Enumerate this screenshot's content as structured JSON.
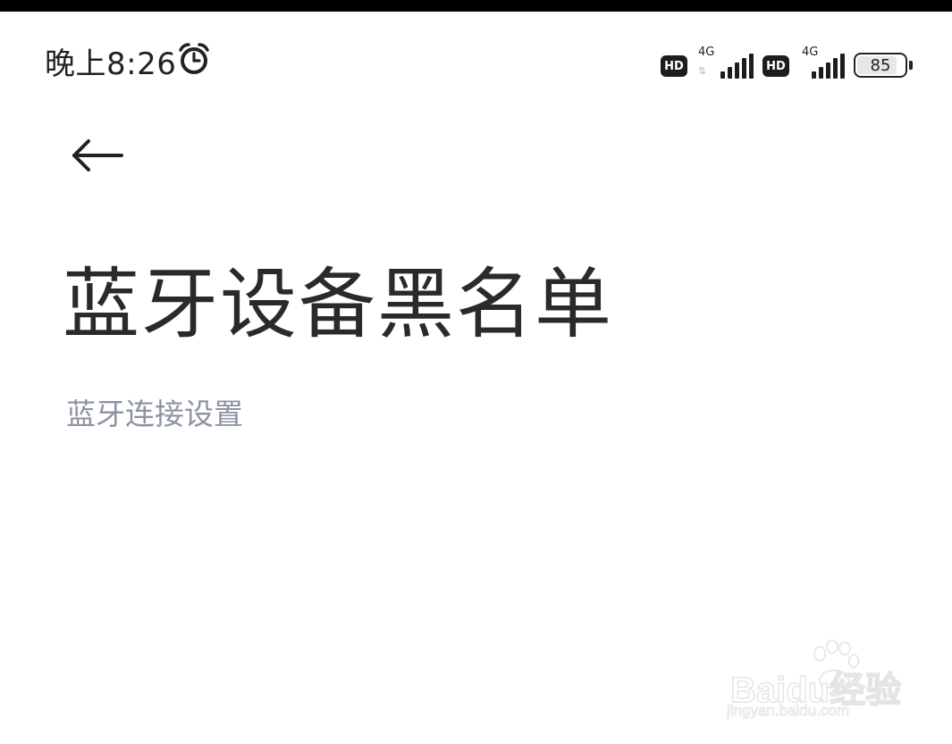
{
  "status_bar": {
    "time": "晚上8:26",
    "alarm_icon": "alarm-clock-icon",
    "sim1": {
      "hd": "HD",
      "network": "4G",
      "bars": 5
    },
    "sim2": {
      "hd": "HD",
      "network": "4G",
      "bars": 5
    },
    "battery": {
      "percent": "85",
      "level": 0.85
    }
  },
  "header": {
    "back_icon": "arrow-left-icon"
  },
  "page": {
    "title": "蓝牙设备黑名单",
    "section_header": "蓝牙连接设置"
  },
  "watermark": {
    "logo_text": "Baidu经验",
    "url": "jingyan.baidu.com"
  },
  "colors": {
    "title": "#2a2a2a",
    "section_header": "#8d93a1",
    "background": "#ffffff"
  }
}
